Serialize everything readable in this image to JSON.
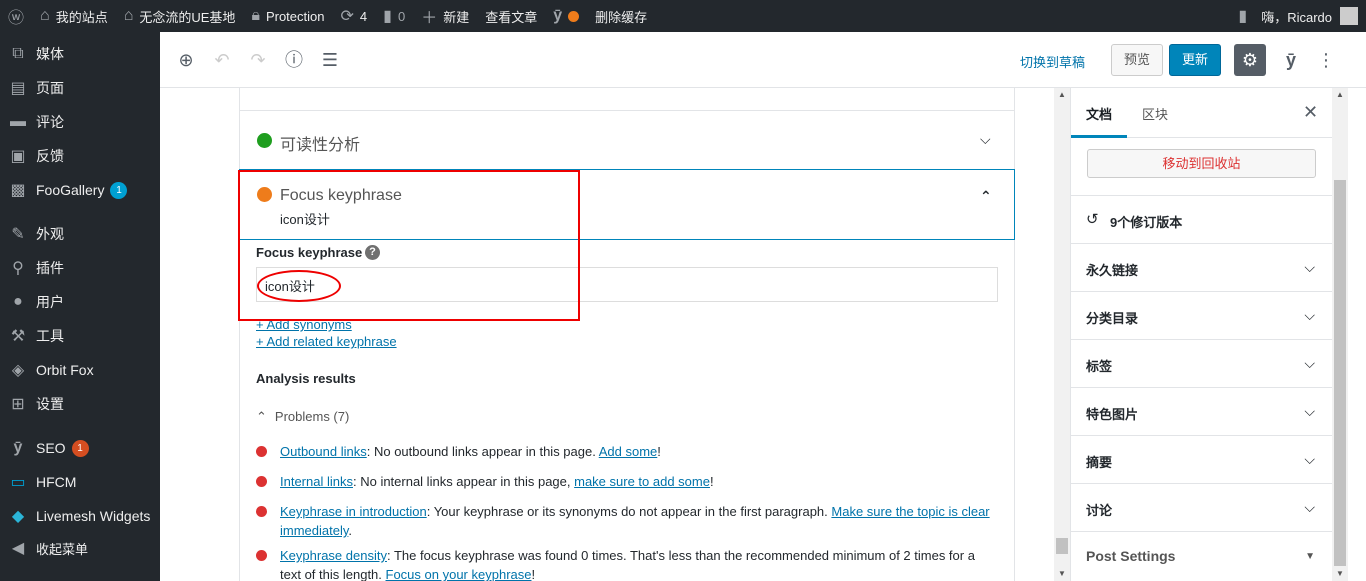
{
  "adminbar": {
    "wp_icon": "wordpress-logo-icon",
    "site_name": "我的站点",
    "theme_site": "无念流的UE基地",
    "protection": "Protection",
    "updates_count": "4",
    "comments_count": "0",
    "new_label": "新建",
    "view_post": "查看文章",
    "clear_cache": "删除缓存",
    "greeting": "嗨，Ricardo"
  },
  "sidebar": {
    "items": [
      {
        "label": "媒体",
        "icon": "media-icon"
      },
      {
        "label": "页面",
        "icon": "pages-icon"
      },
      {
        "label": "评论",
        "icon": "comments-icon"
      },
      {
        "label": "反馈",
        "icon": "feedback-icon"
      },
      {
        "label": "FooGallery",
        "icon": "foogallery-icon",
        "badge": "1"
      },
      {
        "label": "外观",
        "icon": "appearance-icon"
      },
      {
        "label": "插件",
        "icon": "plugins-icon"
      },
      {
        "label": "用户",
        "icon": "users-icon"
      },
      {
        "label": "工具",
        "icon": "tools-icon"
      },
      {
        "label": "Orbit Fox",
        "icon": "orbit-fox-icon"
      },
      {
        "label": "设置",
        "icon": "settings-icon"
      },
      {
        "label": "SEO",
        "icon": "yoast-icon",
        "badge": "1"
      },
      {
        "label": "HFCM",
        "icon": "hfcm-icon"
      },
      {
        "label": "Livemesh Widgets",
        "icon": "livemesh-icon"
      },
      {
        "label": "收起菜单",
        "icon": "collapse-icon"
      }
    ]
  },
  "toolbar": {
    "switch_to_draft": "切换到草稿",
    "preview": "预览",
    "update": "更新"
  },
  "editor": {
    "readability_title": "可读性分析",
    "focus_title": "Focus keyphrase",
    "focus_value_summary": "icon设计",
    "field_label": "Focus keyphrase",
    "field_value": "icon设计",
    "add_synonyms": "+ Add synonyms",
    "add_related": "+ Add related keyphrase",
    "analysis_heading": "Analysis results",
    "problems_label": "Problems (7)",
    "results": [
      {
        "link": "Outbound links",
        "text": ": No outbound links appear in this page. ",
        "link2": "Add some",
        "tail": "!"
      },
      {
        "link": "Internal links",
        "text": ": No internal links appear in this page, ",
        "link2": "make sure to add some",
        "tail": "!"
      },
      {
        "link": "Keyphrase in introduction",
        "text": ": Your keyphrase or its synonyms do not appear in the first paragraph. ",
        "link2": "Make sure the topic is clear immediately",
        "tail": "."
      },
      {
        "link": "Keyphrase density",
        "text": ": The focus keyphrase was found 0 times. That's less than the recommended minimum of 2 times for a text of this length. ",
        "link2": "Focus on your keyphrase",
        "tail": "!"
      }
    ]
  },
  "settings": {
    "tab_document": "文档",
    "tab_block": "区块",
    "move_to_trash": "移动到回收站",
    "revisions": "9个修订版本",
    "rows": [
      "永久链接",
      "分类目录",
      "标签",
      "特色图片",
      "摘要",
      "讨论"
    ],
    "post_settings": "Post Settings"
  },
  "colors": {
    "admin_bg": "#23282d",
    "accent": "#0085ba",
    "error": "#dc3232",
    "ok": "#1f9e1f",
    "warn": "#ee7c1b"
  }
}
